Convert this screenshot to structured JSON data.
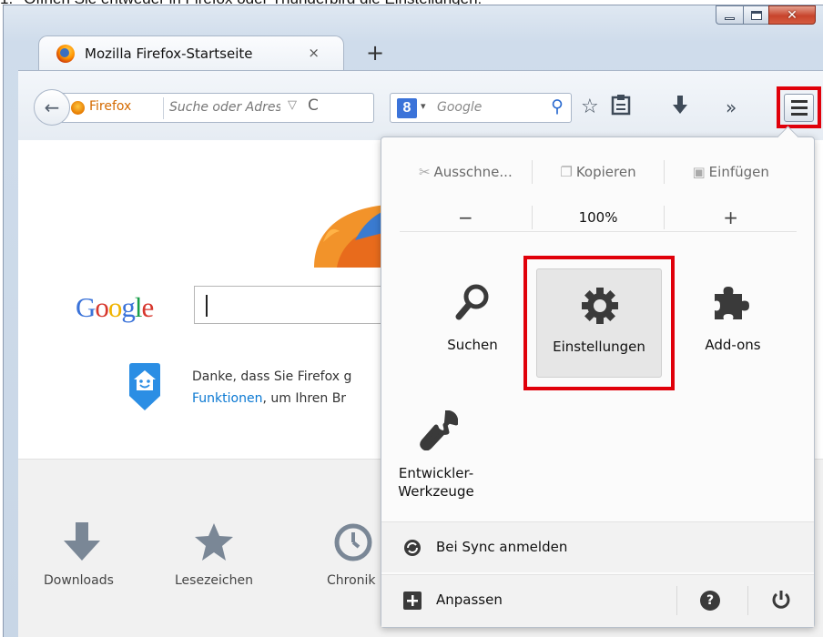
{
  "caption": {
    "number": "1.",
    "text": "Öffnen Sie entweder in Firefox oder Thunderbird die Einstellungen:"
  },
  "window": {
    "min_label": "minimize",
    "max_label": "maximize",
    "close_label": "close"
  },
  "tab": {
    "title": "Mozilla Firefox-Startseite",
    "close_glyph": "×",
    "new_tab_glyph": "+"
  },
  "navbar": {
    "identity_label": "Firefox",
    "url_placeholder": "Suche oder Adress",
    "search_placeholder": "Google",
    "icons": [
      "bookmark-star-icon",
      "reading-list-icon",
      "downloads-icon",
      "overflow-chevron-icon",
      "menu-hamburger-icon"
    ]
  },
  "content": {
    "google_logo": "Google",
    "snippet_line1": "Danke, dass Sie Firefox g",
    "snippet_link": "Funktionen",
    "snippet_line2_rest": ", um Ihren Br",
    "launchers": [
      {
        "label": "Downloads",
        "icon": "download-arrow-icon"
      },
      {
        "label": "Lesezeichen",
        "icon": "star-icon"
      },
      {
        "label": "Chronik",
        "icon": "clock-icon"
      }
    ]
  },
  "panel": {
    "edit": {
      "cut": "Ausschne...",
      "copy": "Kopieren",
      "paste": "Einfügen"
    },
    "zoom": {
      "minus": "−",
      "level": "100%",
      "plus": "+"
    },
    "items": [
      {
        "label": "Suchen",
        "icon": "search-icon"
      },
      {
        "label": "Einstellungen",
        "icon": "gear-icon"
      },
      {
        "label": "Add-ons",
        "icon": "puzzle-icon"
      },
      {
        "label_line1": "Entwickler-",
        "label_line2": "Werkzeuge",
        "icon": "wrench-icon"
      }
    ],
    "sync": "Bei Sync anmelden",
    "customize": "Anpassen"
  },
  "colors": {
    "highlight": "#e0000a",
    "link": "#0a78d2",
    "accent": "#d46a00"
  }
}
